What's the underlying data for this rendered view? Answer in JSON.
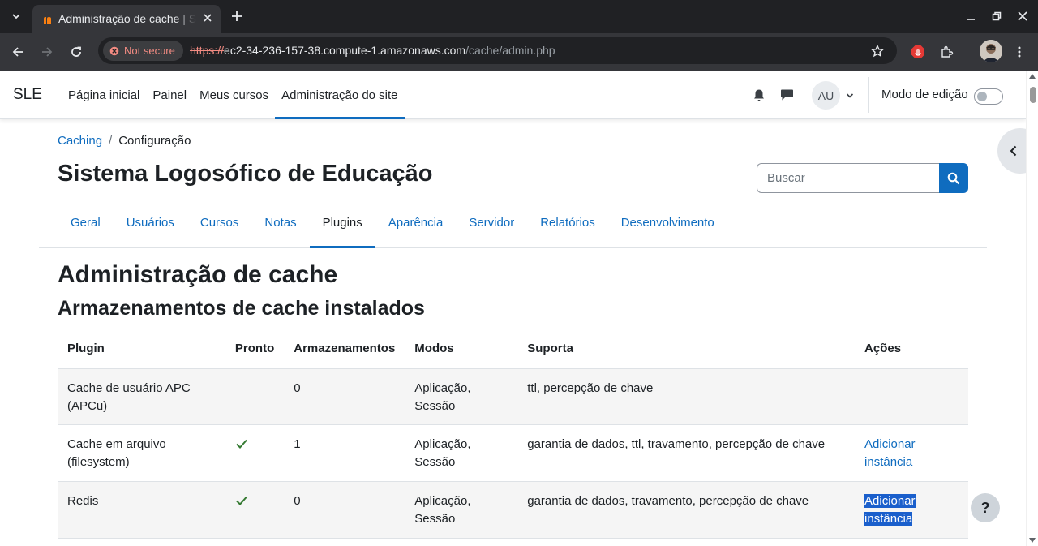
{
  "browser": {
    "tab_title": "Administração de cache | SLE",
    "security_label": "Not secure",
    "url_scheme": "https://",
    "url_host": "ec2-34-236-157-38.compute-1.amazonaws.com",
    "url_path": "/cache/admin.php"
  },
  "navbar": {
    "brand": "SLE",
    "items": [
      {
        "label": "Página inicial",
        "active": false
      },
      {
        "label": "Painel",
        "active": false
      },
      {
        "label": "Meus cursos",
        "active": false
      },
      {
        "label": "Administração do site",
        "active": true
      }
    ],
    "avatar_initials": "AU",
    "edit_mode_label": "Modo de edição",
    "edit_mode_on": false
  },
  "breadcrumb": {
    "link": "Caching",
    "separator": "/",
    "current": "Configuração"
  },
  "site_title": "Sistema Logosófico de Educação",
  "search": {
    "placeholder": "Buscar"
  },
  "secondary_nav": [
    {
      "label": "Geral"
    },
    {
      "label": "Usuários"
    },
    {
      "label": "Cursos"
    },
    {
      "label": "Notas"
    },
    {
      "label": "Plugins",
      "active": true
    },
    {
      "label": "Aparência"
    },
    {
      "label": "Servidor"
    },
    {
      "label": "Relatórios"
    },
    {
      "label": "Desenvolvimento"
    }
  ],
  "page_heading": "Administração de cache",
  "section_heading": "Armazenamentos de cache instalados",
  "table": {
    "headers": [
      "Plugin",
      "Pronto",
      "Armazenamentos",
      "Modos",
      "Suporta",
      "Ações"
    ],
    "rows": [
      {
        "plugin_line1": "Cache de usuário APC",
        "plugin_line2": "(APCu)",
        "ready": false,
        "stores": "0",
        "modes_line1": "Aplicação,",
        "modes_line2": "Sessão",
        "supports": "ttl, percepção de chave",
        "action_line1": "",
        "action_line2": ""
      },
      {
        "plugin_line1": "Cache em arquivo",
        "plugin_line2": "(filesystem)",
        "ready": true,
        "stores": "1",
        "modes_line1": "Aplicação,",
        "modes_line2": "Sessão",
        "supports": "garantia de dados, ttl, travamento, percepção de chave",
        "action_line1": "Adicionar",
        "action_line2": "instância"
      },
      {
        "plugin_line1": "Redis",
        "plugin_line2": "",
        "ready": true,
        "stores": "0",
        "modes_line1": "Aplicação,",
        "modes_line2": "Sessão",
        "supports": "garantia de dados, travamento, percepção de chave",
        "action_line1": "Adicionar",
        "action_line2": "instância"
      }
    ]
  },
  "help_button": "?",
  "colors": {
    "link": "#0f6cbf",
    "selection": "#1a5fcc",
    "check": "#357a32"
  }
}
